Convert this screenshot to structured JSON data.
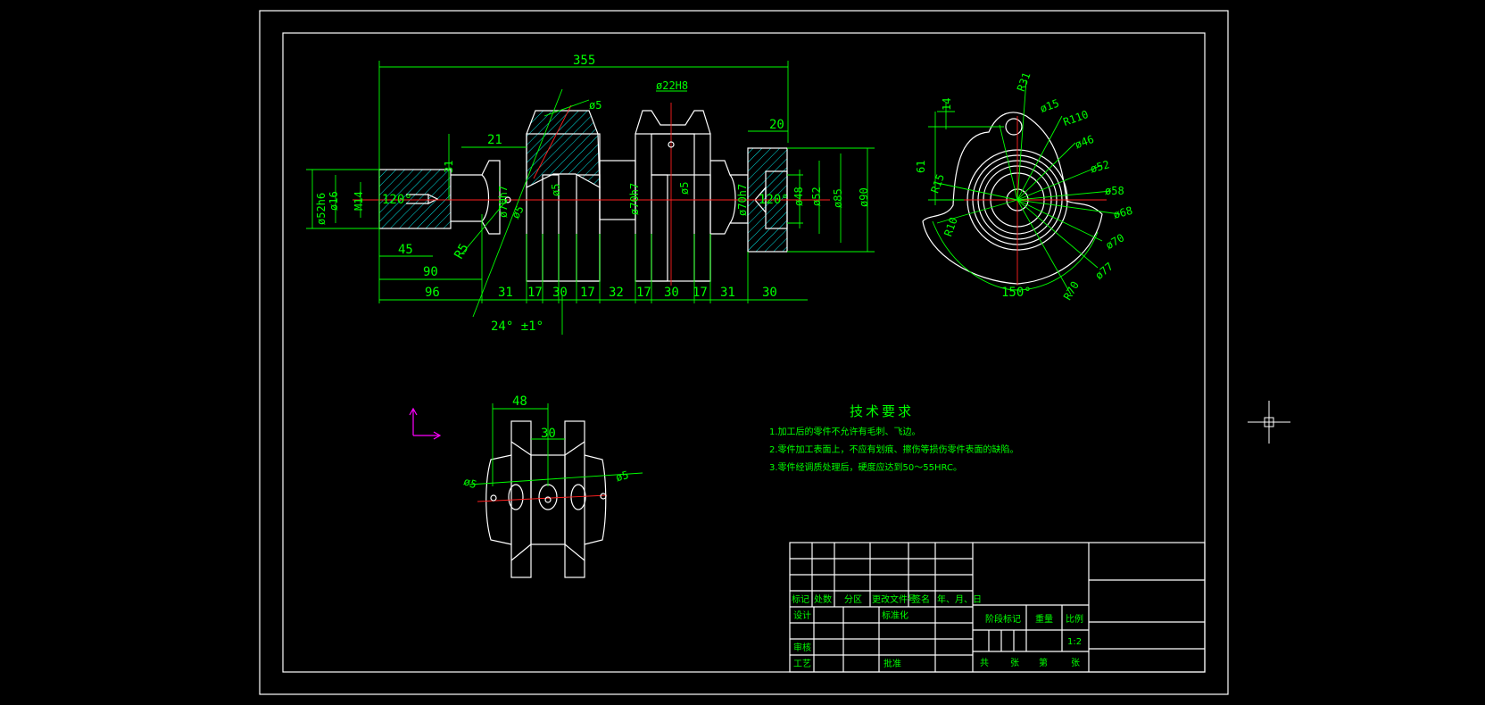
{
  "drawing": {
    "main_view": {
      "dims": {
        "overall_length": "355",
        "bore_22": "ø22H8",
        "hole_5_top": "ø5",
        "len_20": "20",
        "len_21": "21",
        "len_31_v": "31",
        "dia_52h6": "ø52h6",
        "dia_16": "ø16",
        "m14": "M14",
        "ang_120_l": "120°",
        "dia_70h7_a": "ø70h7",
        "dia_70h7_b": "ø70h7",
        "dia_70h7_c": "ø70h7",
        "dia_5_mid": "ø5",
        "dia_5_side": "ø5",
        "dia_5_right": "ø5",
        "ang_120_r": "120°",
        "dia_48": "ø48",
        "dia_52": "ø52",
        "dia_85": "ø85",
        "dia_90": "ø90",
        "len_45": "45",
        "r5": "R5",
        "len_90": "90",
        "len_96": "96",
        "seg_31a": "31",
        "seg_17a": "17",
        "seg_30a": "30",
        "seg_17b": "17",
        "seg_32": "32",
        "seg_17c": "17",
        "seg_30b": "30",
        "seg_17d": "17",
        "seg_31b": "31",
        "seg_30c": "30",
        "angle_tol": "24° ±1°"
      }
    },
    "side_view": {
      "dims": {
        "d14": "14",
        "r31": "R31",
        "d15": "ø15",
        "r110": "R110",
        "d46": "ø46",
        "d61": "61",
        "d52": "ø52",
        "r15": "R15",
        "d58": "ø58",
        "d68": "ø68",
        "r10": "R10",
        "d70": "ø70",
        "d77": "ø77",
        "r70": "R70",
        "ang150": "150°"
      }
    },
    "detail_view": {
      "dims": {
        "w48": "48",
        "w30": "30",
        "d5_left": "ø5",
        "d5_right": "ø5"
      }
    },
    "tech_requirements": {
      "title": "技术要求",
      "items": [
        "1.加工后的零件不允许有毛刺、飞边。",
        "2.零件加工表面上，不应有划痕、擦伤等损伤零件表面的缺陷。",
        "3.零件经调质处理后，硬度应达到50～55HRC。"
      ]
    },
    "title_block": {
      "col_mark": "标记",
      "col_count": "处数",
      "col_zone": "分区",
      "col_change_doc": "更改文件号",
      "col_sign": "签名",
      "col_date": "年、月、日",
      "design": "设计",
      "standardize": "标准化",
      "review": "审核",
      "process": "工艺",
      "approve": "批准",
      "stage_mark": "阶段标记",
      "weight": "重量",
      "scale_label": "比例",
      "scale_value": "1:2",
      "sheets_total": "共",
      "sheets_unit1": "张",
      "sheets_no": "第",
      "sheets_unit2": "张"
    }
  },
  "colors": {
    "background": "#000000",
    "outline": "#ffffff",
    "dimension": "#00ff00",
    "centerline": "#ff2020",
    "ucs_icon": "#ff00ff",
    "hatch": "#00ffff"
  },
  "icons": [
    "ucs-axis-icon",
    "crosshair-cursor-icon"
  ]
}
